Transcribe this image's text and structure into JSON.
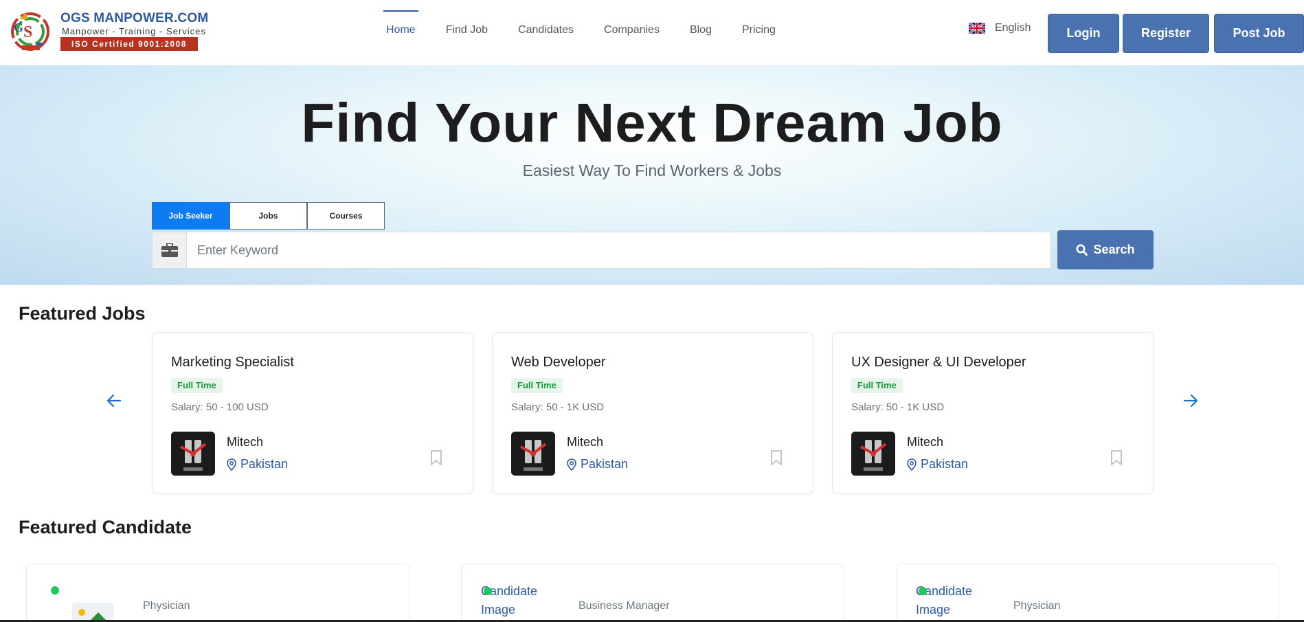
{
  "header": {
    "logo": {
      "title": "OGS MANPOWER.COM",
      "subtitle": "Manpower - Training - Services",
      "iso": "ISO Certified 9001:2008"
    },
    "nav": [
      "Home",
      "Find Job",
      "Candidates",
      "Companies",
      "Blog",
      "Pricing"
    ],
    "active_nav": "Home",
    "language": "English",
    "buttons": {
      "login": "Login",
      "register": "Register",
      "post_job": "Post Job"
    }
  },
  "hero": {
    "title": "Find Your Next Dream Job",
    "subtitle": "Easiest Way To Find Workers & Jobs",
    "tabs": [
      "Job Seeker",
      "Jobs",
      "Courses"
    ],
    "active_tab": "Job Seeker",
    "search": {
      "placeholder": "Enter Keyword",
      "value": "",
      "button": "Search"
    }
  },
  "featured_jobs": {
    "title": "Featured Jobs",
    "jobs": [
      {
        "title": "Marketing Specialist",
        "type": "Full Time",
        "salary": "Salary: 50 - 100 USD",
        "company": "Mitech",
        "location": "Pakistan"
      },
      {
        "title": "Web Developer",
        "type": "Full Time",
        "salary": "Salary: 50 - 1K USD",
        "company": "Mitech",
        "location": "Pakistan"
      },
      {
        "title": "UX Designer & UI Developer",
        "type": "Full Time",
        "salary": "Salary: 50 - 1K USD",
        "company": "Mitech",
        "location": "Pakistan"
      }
    ]
  },
  "featured_candidates": {
    "title": "Featured Candidate",
    "candidates": [
      {
        "role": "Physician",
        "image_alt": ""
      },
      {
        "role": "Business Manager",
        "image_alt": "Candidate Image"
      },
      {
        "role": "Physician",
        "image_alt": "Candidate Image"
      }
    ]
  },
  "colors": {
    "primary": "#4a72b0",
    "active_tab": "#0d7cf2",
    "badge_green": "#1a9a3d",
    "link_blue": "#2d5aa3"
  },
  "icons": [
    "briefcase-icon",
    "search-icon",
    "arrow-left-icon",
    "arrow-right-icon",
    "map-pin-icon",
    "bookmark-icon",
    "uk-flag-icon"
  ]
}
